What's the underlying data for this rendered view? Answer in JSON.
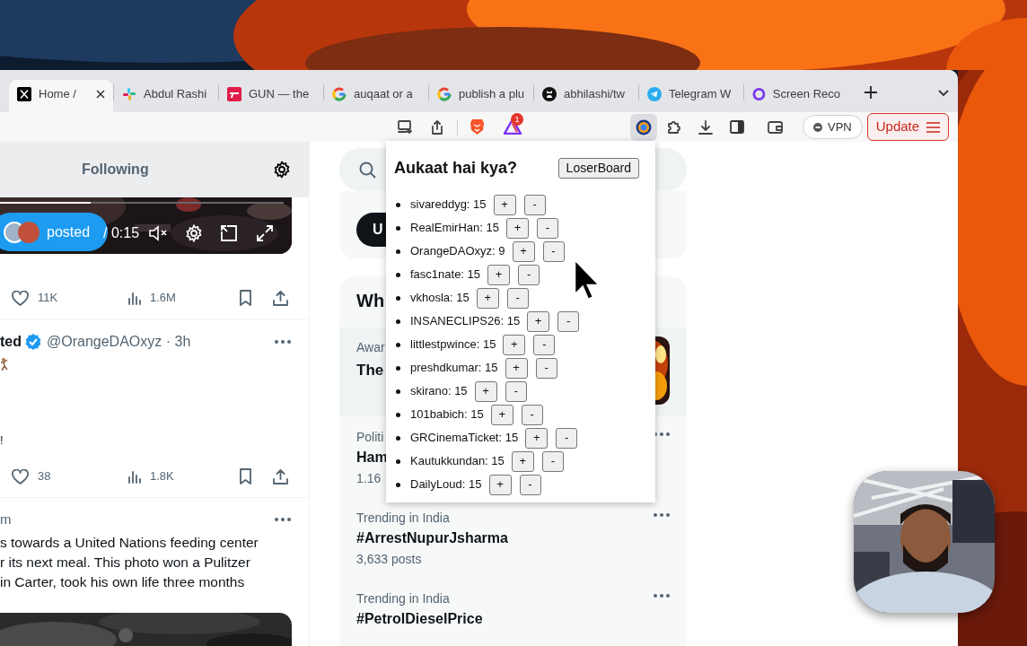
{
  "browser": {
    "tabs": [
      {
        "title": "Home /",
        "selected": true
      },
      {
        "title": "Abdul Rashi",
        "selected": false
      },
      {
        "title": "GUN — the",
        "selected": false
      },
      {
        "title": "auqaat or a",
        "selected": false
      },
      {
        "title": "publish a plu",
        "selected": false
      },
      {
        "title": "abhilashi/tw",
        "selected": false
      },
      {
        "title": "Telegram W",
        "selected": false
      },
      {
        "title": "Screen Reco",
        "selected": false
      }
    ],
    "toolbar": {
      "extension_badge": "1",
      "vpn": "VPN",
      "update": "Update"
    }
  },
  "timeline": {
    "header": "Following",
    "video": {
      "badge": "posted",
      "time": "/ 0:15",
      "progress": {
        "level": 0.32
      }
    },
    "posts": [
      {
        "likes": "11K",
        "views": "1.6M"
      },
      {
        "name": "ted",
        "verified": true,
        "handle": "@OrangeDAOxyz · 3h",
        "fragment": "!",
        "likes": "38",
        "views": "1.8K"
      },
      {
        "time": "m",
        "text": "s towards a United Nations feeding center\nr its next meal. This photo won a Pulitzer\nin Carter, took his own life three months"
      }
    ]
  },
  "sidebar": {
    "pill_button": "U",
    "section_title": "Wh",
    "trends": [
      {
        "kind": "featured",
        "category": "Awar",
        "title": "The"
      },
      {
        "kind": "trend",
        "category": "Politi",
        "title": "Ham",
        "count": "1.16"
      },
      {
        "kind": "trend",
        "category": "Trending in India",
        "title": "#ArrestNupurJsharma",
        "count": "3,633 posts"
      },
      {
        "kind": "trend",
        "category": "Trending in India",
        "title": "#PetrolDieselPrice"
      }
    ]
  },
  "popup": {
    "title": "Aukaat hai kya?",
    "button": "LoserBoard",
    "entries": [
      {
        "label": "sivareddyg: 15",
        "plus": "+",
        "minus": "-"
      },
      {
        "label": "RealEmirHan: 15",
        "plus": "+",
        "minus": "-"
      },
      {
        "label": "OrangeDAOxyz: 9",
        "plus": "+",
        "minus": "-"
      },
      {
        "label": "fasc1nate: 15",
        "plus": "+",
        "minus": "-"
      },
      {
        "label": "vkhosla: 15",
        "plus": "+",
        "minus": "-"
      },
      {
        "label": "INSANECLIPS26: 15",
        "plus": "+",
        "minus": "-"
      },
      {
        "label": "littlestpwince: 15",
        "plus": "+",
        "minus": "-"
      },
      {
        "label": "preshdkumar: 15",
        "plus": "+",
        "minus": "-"
      },
      {
        "label": "skirano: 15",
        "plus": "+",
        "minus": "-"
      },
      {
        "label": "101babich: 15",
        "plus": "+",
        "minus": "-"
      },
      {
        "label": "GRCinemaTicket: 15",
        "plus": "+",
        "minus": "-"
      },
      {
        "label": "Kautukkundan: 15",
        "plus": "+",
        "minus": "-"
      },
      {
        "label": "DailyLoud: 15",
        "plus": "+",
        "minus": "-"
      }
    ]
  }
}
